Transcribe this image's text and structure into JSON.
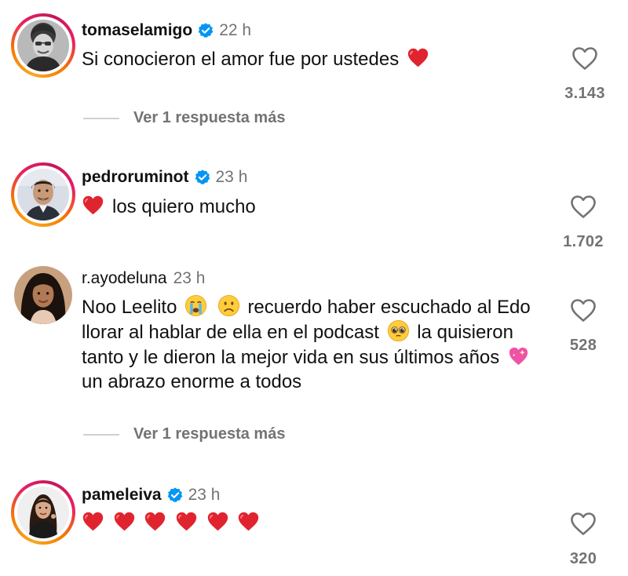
{
  "colors": {
    "heart": "#e0242f",
    "verified": "#0095f6",
    "muted_text": "#737373"
  },
  "comments": [
    {
      "username": "tomaselamigo",
      "verified": true,
      "time": "22 h",
      "text_segments": [
        "Si conocieron el amor fue por ustedes",
        "red-heart-emoji"
      ],
      "text": "Si conocieron el amor fue por ustedes",
      "likes": "3.143",
      "replies_label": "Ver 1 respuesta más",
      "avatar_icon": "avatar-tomaselamigo"
    },
    {
      "username": "pedroruminot",
      "verified": true,
      "time": "23 h",
      "text": "los quiero mucho",
      "likes": "1.702",
      "avatar_icon": "avatar-pedroruminot"
    },
    {
      "username": "r.ayodeluna",
      "verified": false,
      "time": "23 h",
      "text_part1": "Noo Leelito",
      "text_part2": "recuerdo haber escuchado al Edo llorar al hablar de ella en el podcast",
      "text_part3": "la quisieron tanto y le dieron la mejor vida en sus últimos años",
      "text_part4": "un abrazo enorme a todos",
      "likes": "528",
      "replies_label": "Ver 1 respuesta más",
      "avatar_icon": "avatar-ayodeluna"
    },
    {
      "username": "pameleiva",
      "verified": true,
      "time": "23 h",
      "emoji_hearts": 6,
      "likes": "320",
      "avatar_icon": "avatar-pameleiva"
    }
  ],
  "icons": {
    "like": "heart-outline-icon",
    "verified": "verified-badge-icon"
  }
}
